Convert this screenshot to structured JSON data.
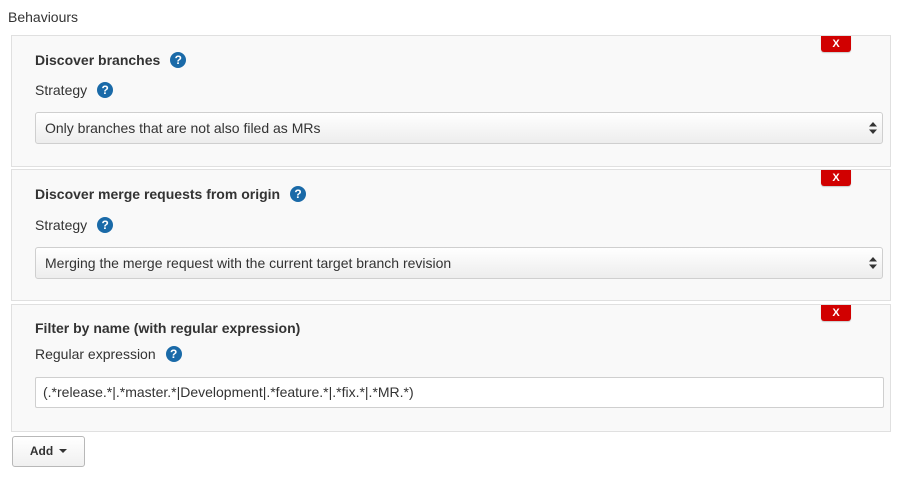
{
  "section": {
    "title": "Behaviours"
  },
  "behaviours": [
    {
      "title": "Discover branches",
      "delete_label": "X",
      "help_glyph": "?",
      "field_label": "Strategy",
      "field_type": "select",
      "value": "Only branches that are not also filed as MRs"
    },
    {
      "title": "Discover merge requests from origin",
      "delete_label": "X",
      "help_glyph": "?",
      "field_label": "Strategy",
      "field_type": "select",
      "value": "Merging the merge request with the current target branch revision"
    },
    {
      "title": "Filter by name (with regular expression)",
      "delete_label": "X",
      "help_glyph": "?",
      "field_label": "Regular expression",
      "field_type": "text",
      "value": "(.*release.*|.*master.*|Development|.*feature.*|.*fix.*|.*MR.*)"
    }
  ],
  "add_button": {
    "label": "Add"
  },
  "colors": {
    "delete": "#d10000",
    "help": "#1a6aa8",
    "panel_bg": "#f9f9f9"
  }
}
